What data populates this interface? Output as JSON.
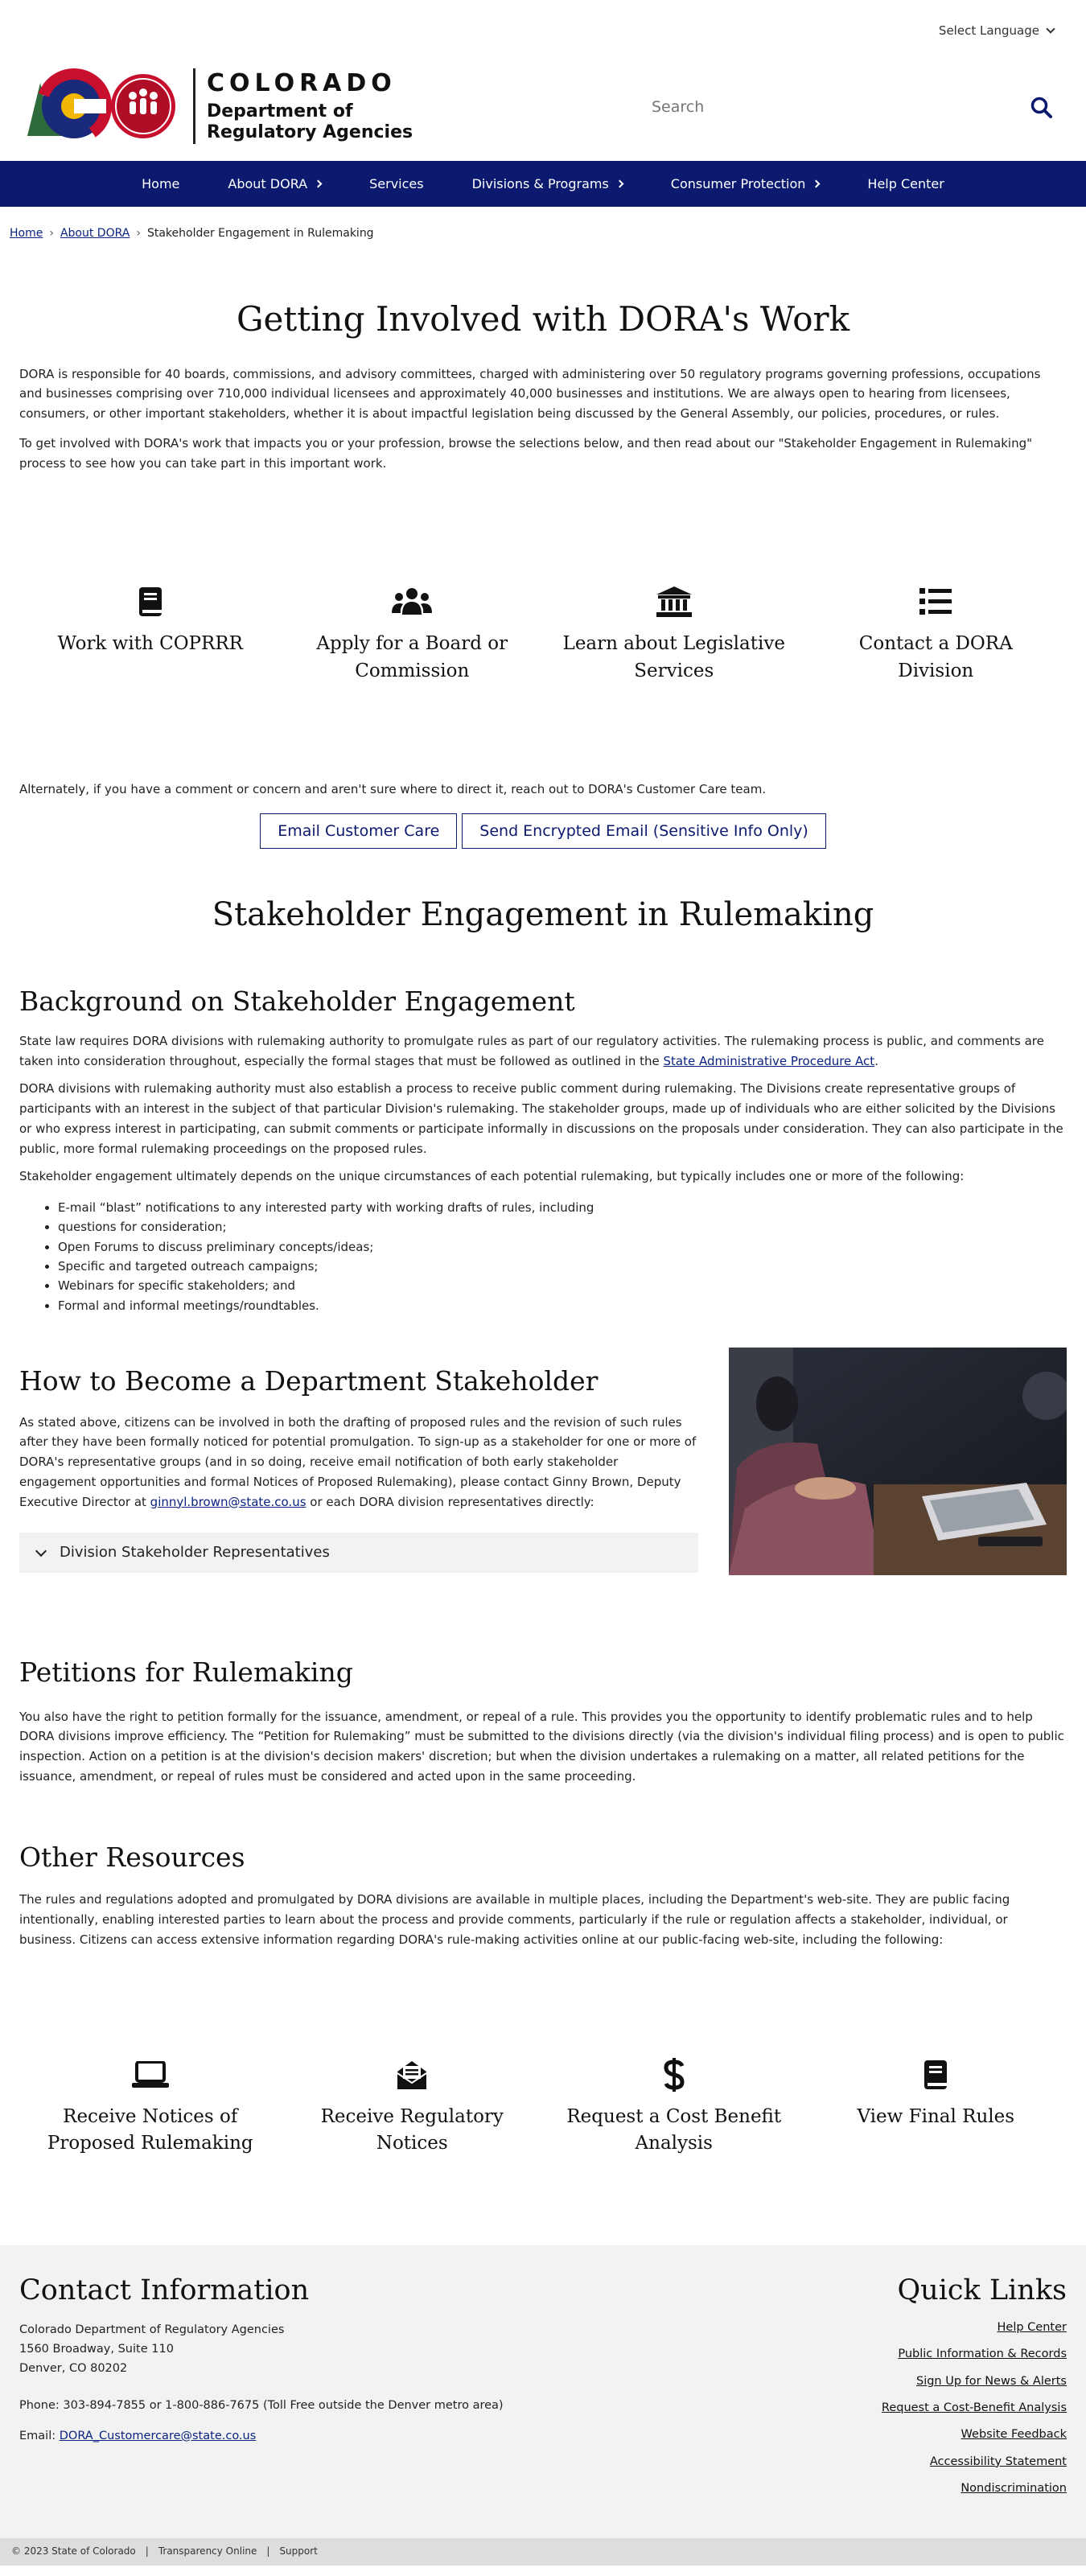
{
  "utility": {
    "language": "Select Language"
  },
  "header": {
    "logo_badge": "DORA",
    "title": "COLORADO",
    "subtitle_line1": "Department of",
    "subtitle_line2": "Regulatory Agencies",
    "search_placeholder": "Search"
  },
  "nav": {
    "items": [
      {
        "label": "Home",
        "has_submenu": false
      },
      {
        "label": "About DORA",
        "has_submenu": true
      },
      {
        "label": "Services",
        "has_submenu": false
      },
      {
        "label": "Divisions & Programs",
        "has_submenu": true
      },
      {
        "label": "Consumer Protection",
        "has_submenu": true
      },
      {
        "label": "Help Center",
        "has_submenu": false
      }
    ]
  },
  "breadcrumb": {
    "home": "Home",
    "about": "About DORA",
    "current": "Stakeholder Engagement in Rulemaking",
    "separator": "›"
  },
  "main": {
    "title": "Getting Involved with DORA's Work",
    "intro_p1": "DORA is responsible for 40 boards, commissions, and advisory committees, charged with administering over 50 regulatory programs governing professions, occupations and businesses comprising over 710,000 individual licensees and approximately 40,000 businesses and institutions. We are always open to hearing from licensees, consumers, or other important stakeholders, whether it is about impactful legislation being discussed by the General Assembly, our policies, procedures, or rules.",
    "intro_p2": "To get involved with DORA's work that impacts you or your profession, browse the selections below, and then read about our \"Stakeholder Engagement in Rulemaking\" process to see how you can take part in this important work.",
    "cards": [
      {
        "icon": "book-icon",
        "label": "Work with COPRRR"
      },
      {
        "icon": "users-icon",
        "label": "Apply for a Board or Commission"
      },
      {
        "icon": "landmark-icon",
        "label": "Learn about Legislative Services"
      },
      {
        "icon": "list-icon",
        "label": "Contact a DORA Division"
      }
    ],
    "alt_text": "Alternately, if you have a comment or concern and aren't sure where to direct it, reach out to DORA's Customer Care team.",
    "btn_email": "Email Customer Care",
    "btn_encrypted": "Send Encrypted Email (Sensitive Info Only)",
    "section_title": "Stakeholder Engagement in Rulemaking"
  },
  "background": {
    "title": "Background on Stakeholder Engagement",
    "p1_before": "State law requires DORA divisions with rulemaking authority to promulgate rules as part of our regulatory activities. The rulemaking process is public, and comments are taken into consideration throughout, especially the formal stages that must be followed as outlined in the ",
    "p1_link": "State Administrative Procedure Act",
    "p1_after": ".",
    "p2": "DORA divisions with rulemaking authority must also establish a process to receive public comment during rulemaking. The Divisions create representative groups of participants with an interest in the subject of that particular Division's rulemaking. The stakeholder groups, made up of individuals who are either solicited by the Divisions or who express interest in participating, can submit comments or participate informally in discussions on the proposals under consideration. They can also participate in the public, more formal rulemaking proceedings on the proposed rules.",
    "p3": "Stakeholder engagement ultimately depends on the unique circumstances of each potential rulemaking, but typically includes one or more of the following:",
    "bullets": [
      "E-mail “blast” notifications to any interested party with working drafts of rules, including",
      "questions for consideration;",
      "Open Forums to discuss preliminary concepts/ideas;",
      "Specific and targeted outreach campaigns;",
      "Webinars for specific stakeholders; and",
      "Formal and informal meetings/roundtables."
    ]
  },
  "become": {
    "title": "How to Become a Department Stakeholder",
    "p_before": "As stated above, citizens can be involved in both the drafting of proposed rules and the revision of such rules after they have been formally noticed for potential promulgation. To sign-up as a stakeholder for one or more of DORA's representative groups (and in so doing, receive email notification of both early stakeholder engagement opportunities and formal Notices of Proposed Rulemaking), please contact Ginny Brown, Deputy Executive Director at ",
    "p_link": "ginnyl.brown@state.co.us",
    "p_after": " or each DORA division representatives directly:",
    "accordion": "Division Stakeholder Representatives"
  },
  "petitions": {
    "title": "Petitions for Rulemaking",
    "p": "You also have the right to petition formally for the issuance, amendment, or repeal of a rule. This provides you the opportunity to identify problematic rules and to help DORA divisions improve efficiency. The “Petition for Rulemaking” must be submitted to the divisions directly (via the division's individual filing process) and is open to public inspection. Action on a petition is at the division's decision makers' discretion; but when the division undertakes a rulemaking on a matter, all related petitions for the issuance, amendment, or repeal of rules must be considered and acted upon in the same proceeding."
  },
  "resources": {
    "title": "Other Resources",
    "p": "The rules and regulations adopted and promulgated by DORA divisions are available in multiple places, including the Department's web-site. They are public facing intentionally, enabling interested parties to learn about the process and provide comments, particularly if the rule or regulation affects a stakeholder, individual, or business. Citizens can access extensive information regarding DORA's rule-making activities online at our public-facing web-site, including the following:",
    "cards": [
      {
        "icon": "laptop-icon",
        "label": "Receive Notices of Proposed Rulemaking"
      },
      {
        "icon": "envelope-open-icon",
        "label": "Receive Regulatory Notices"
      },
      {
        "icon": "dollar-icon",
        "label": "Request a Cost Benefit Analysis"
      },
      {
        "icon": "book-icon",
        "label": "View Final Rules"
      }
    ]
  },
  "footer": {
    "contact_title": "Contact Information",
    "org": "Colorado Department of Regulatory Agencies",
    "street": "1560 Broadway, Suite 110",
    "city": "Denver, CO 80202",
    "phone": "Phone: 303-894-7855 or 1-800-886-7675 (Toll Free outside the Denver metro area)",
    "email_label": "Email: ",
    "email": "DORA_Customercare@state.co.us",
    "quick_title": "Quick Links",
    "quick_links": [
      "Help Center",
      "Public Information & Records",
      "Sign Up for News & Alerts",
      "Request a Cost-Benefit Analysis",
      "Website Feedback",
      "Accessibility Statement",
      "Nondiscrimination"
    ],
    "copyright": "© 2023 State of Colorado",
    "transparency": "Transparency Online",
    "support": "Support"
  },
  "colors": {
    "navy": "#0b1a6e",
    "link": "#0b2380",
    "footer_bg": "#f2f2f2"
  }
}
